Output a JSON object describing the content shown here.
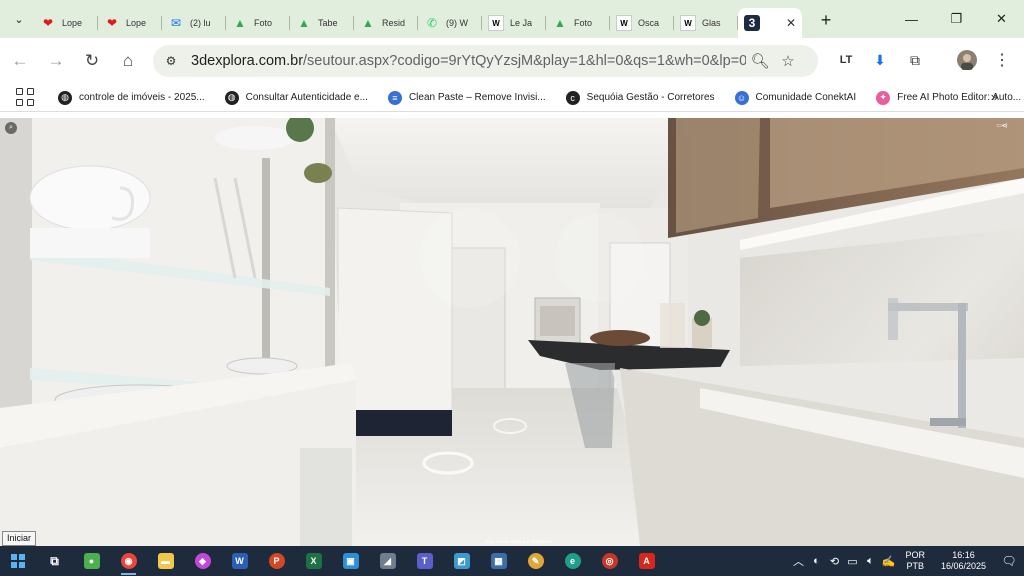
{
  "tabstrip": {
    "tabs": [
      {
        "label": "Lope",
        "icon": "heart-icon",
        "color": "#e8141e"
      },
      {
        "label": "Lope",
        "icon": "heart-icon",
        "color": "#e8141e"
      },
      {
        "label": "(2) lu",
        "icon": "mail-icon",
        "color": "#1a73e8"
      },
      {
        "label": "Foto",
        "icon": "drive-icon",
        "color": "#34a853"
      },
      {
        "label": "Tabe",
        "icon": "drive-icon",
        "color": "#34a853"
      },
      {
        "label": "Resid",
        "icon": "drive-icon",
        "color": "#34a853"
      },
      {
        "label": "(9) W",
        "icon": "whatsapp-icon",
        "color": "#25d366"
      },
      {
        "label": "Le Ja",
        "icon": "wix-icon",
        "color": "#000000"
      },
      {
        "label": "Foto",
        "icon": "drive-icon",
        "color": "#34a853"
      },
      {
        "label": "Osca",
        "icon": "wix-icon",
        "color": "#000000"
      },
      {
        "label": "Glas",
        "icon": "wix-icon",
        "color": "#000000"
      },
      {
        "label": "",
        "icon": "3dexplora-icon",
        "color": "#1d2a44",
        "active": true
      }
    ],
    "new_tab": "+",
    "minimize": "—",
    "restore": "❐",
    "close": "✕"
  },
  "toolbar": {
    "url_host": "3dexplora.com.br",
    "url_rest": "/seutour.aspx?codigo=9rYtQyYzsjM&play=1&hl=0&qs=1&wh=0&lp=0&..."
  },
  "bookmarks": [
    {
      "label": "controle de imóveis - 2025...",
      "icon": "globe-icon",
      "color": "#222222"
    },
    {
      "label": "Consultar Autenticidade e...",
      "icon": "globe-icon",
      "color": "#222222"
    },
    {
      "label": "Clean Paste – Remove Invisi...",
      "icon": "lines-icon",
      "color": "#3b6fd8"
    },
    {
      "label": "Sequóia Gestão - Corretores",
      "icon": "c-icon",
      "color": "#222222"
    },
    {
      "label": "Comunidade ConektAI",
      "icon": "person-icon",
      "color": "#3b6fd8"
    },
    {
      "label": "Free AI Photo Editor: Auto...",
      "icon": "photo-icon",
      "color": "#e85d9a"
    }
  ],
  "viewer": {
    "credit": "Tour virtual criado por 3DExplora"
  },
  "taskbar": {
    "tooltip": "Iniciar",
    "lang_1": "POR",
    "lang_2": "PTB",
    "time": "16:16",
    "date": "16/06/2025"
  }
}
